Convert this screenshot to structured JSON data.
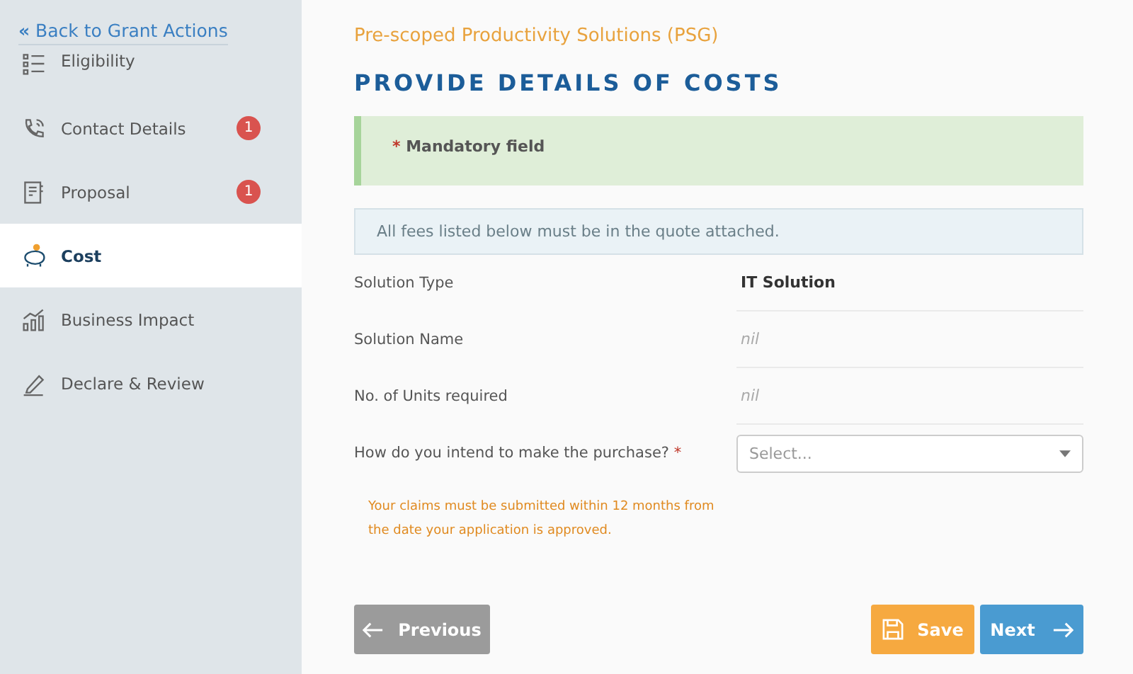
{
  "sidebar": {
    "back_link": {
      "icon": "«",
      "label": "Back to Grant Actions"
    },
    "items": [
      {
        "kind": "list",
        "label": "Eligibility",
        "selected": false
      },
      {
        "kind": "phone",
        "label": "Contact Details",
        "badge": "1",
        "selected": false
      },
      {
        "kind": "document",
        "label": "Proposal",
        "badge": "1",
        "selected": false
      },
      {
        "kind": "piggy",
        "label": "Cost",
        "selected": true
      },
      {
        "kind": "chart",
        "label": "Business Impact",
        "selected": false
      },
      {
        "kind": "pen",
        "label": "Declare & Review",
        "selected": false
      }
    ]
  },
  "header": {
    "subtitle": "Pre-scoped Productivity Solutions (PSG)",
    "title": "PROVIDE DETAILS OF COSTS"
  },
  "mandatory_note": {
    "mark": "*",
    "text": "Mandatory field"
  },
  "info_note": "All fees listed below must be in the quote attached.",
  "fields": [
    {
      "kind": "text",
      "label": "Solution Type",
      "value": "IT Solution"
    },
    {
      "kind": "empty",
      "label": "Solution Name",
      "value": "nil"
    },
    {
      "kind": "empty",
      "label": "No. of Units required",
      "value": "nil"
    },
    {
      "kind": "select",
      "label": "How do you intend to make the purchase?",
      "required": true,
      "placeholder": "Select...",
      "hint": "Your claims must be submitted within 12 months from the date your application is approved."
    }
  ],
  "buttons": {
    "previous": "Previous",
    "save": "Save",
    "next": "Next"
  }
}
